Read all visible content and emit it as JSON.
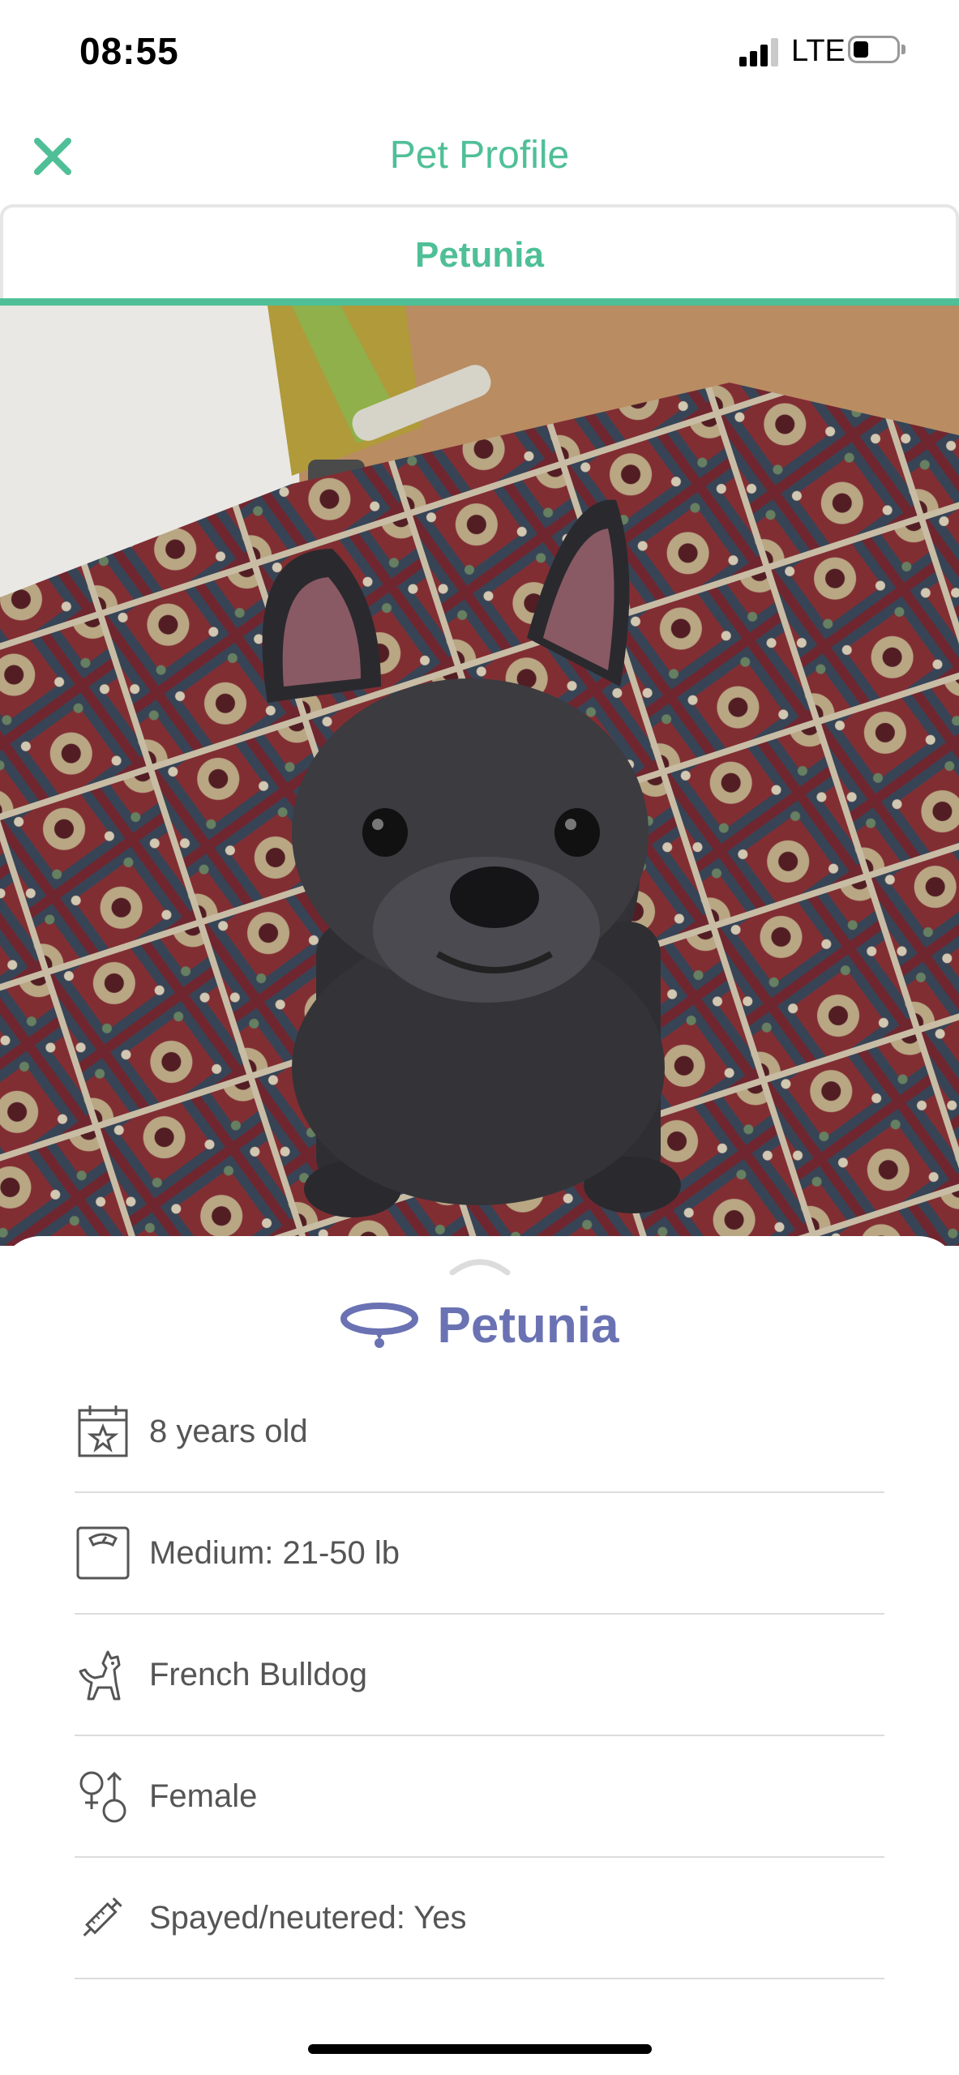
{
  "status_bar": {
    "time": "08:55",
    "network": "LTE",
    "signal_bars_active": 3,
    "battery_level": 0.25
  },
  "header": {
    "title": "Pet Profile",
    "close_icon": "close-icon"
  },
  "tabs": [
    {
      "label": "Petunia",
      "selected": true
    }
  ],
  "photo": {
    "subject": "French Bulldog sitting on patterned rug"
  },
  "profile": {
    "name": "Petunia",
    "name_icon": "collar-icon",
    "details": [
      {
        "icon": "calendar-star-icon",
        "text": "8 years old"
      },
      {
        "icon": "scale-icon",
        "text": "Medium: 21-50 lb"
      },
      {
        "icon": "dog-icon",
        "text": "French Bulldog"
      },
      {
        "icon": "gender-icon",
        "text": "Female"
      },
      {
        "icon": "syringe-icon",
        "text": "Spayed/neutered: Yes"
      }
    ]
  },
  "colors": {
    "accent": "#4fbf97",
    "pet_name": "#6a72b3",
    "icon": "#555555"
  }
}
